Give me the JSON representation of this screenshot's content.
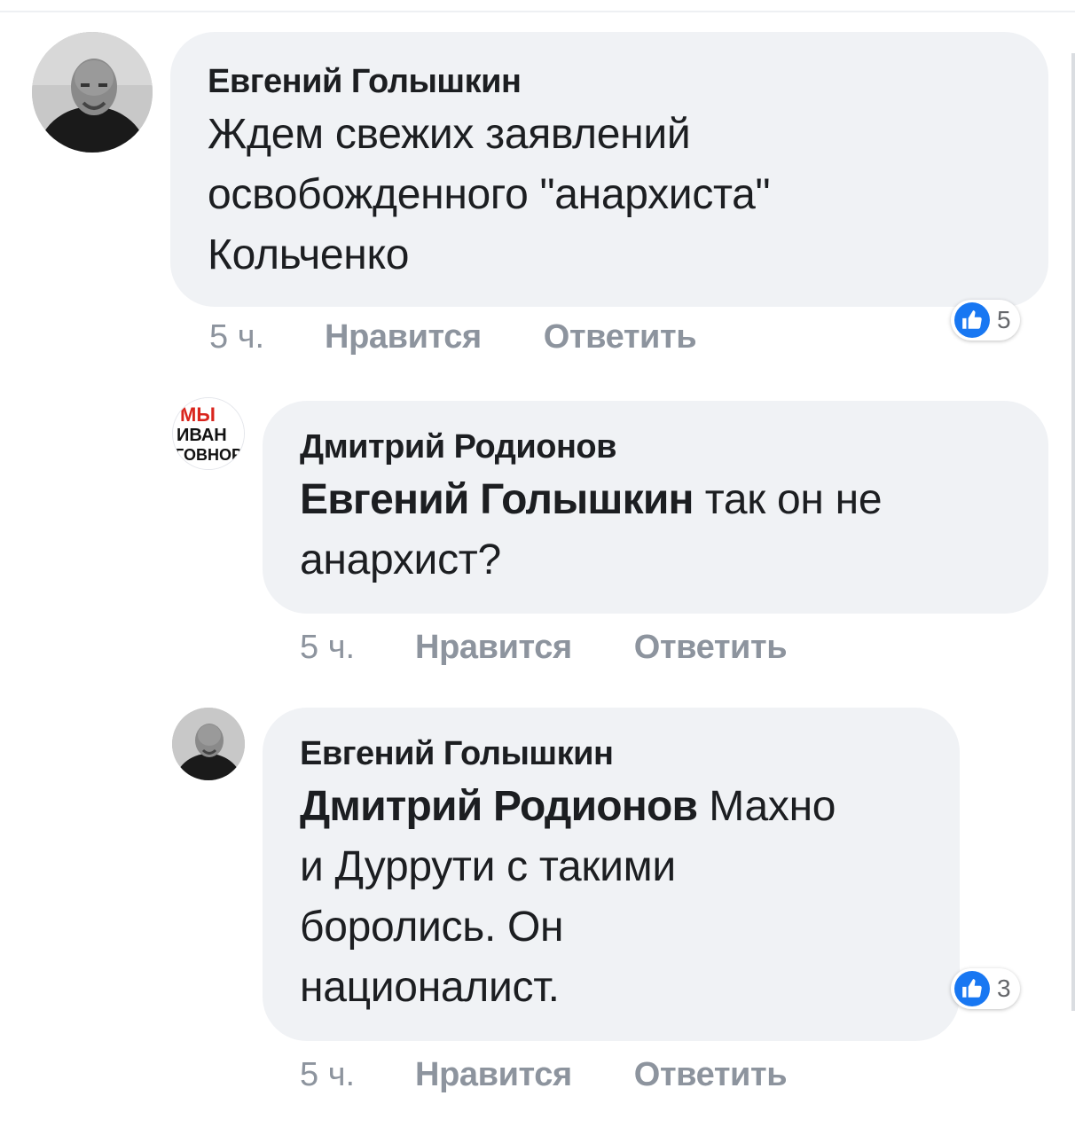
{
  "comments": [
    {
      "author": "Евгений Голышкин",
      "text_lines": [
        "Ждем свежих заявлений",
        "освобожденного \"анархиста\"",
        "Кольченко"
      ],
      "time": "5 ч.",
      "like_label": "Нравится",
      "reply_label": "Ответить",
      "reactions": {
        "icon": "like-icon",
        "count": "5"
      }
    },
    {
      "author": "Дмитрий Родионов",
      "avatar_text": [
        "МЫ",
        "ИВАН",
        "ГОВНОР"
      ],
      "mention": "Евгений Голышкин",
      "text_after_mention": " так он не",
      "text_line2": "анархист?",
      "time": "5 ч.",
      "like_label": "Нравится",
      "reply_label": "Ответить"
    },
    {
      "author": "Евгений Голышкин",
      "mention": "Дмитрий Родионов",
      "text_after_mention": " Махно",
      "text_lines_rest": [
        "и Дуррути с такими",
        "боролись. Он",
        "националист."
      ],
      "time": "5 ч.",
      "like_label": "Нравится",
      "reply_label": "Ответить",
      "reactions": {
        "icon": "like-icon",
        "count": "3"
      }
    }
  ],
  "colors": {
    "bubble": "#f0f2f5",
    "text": "#1c1e21",
    "meta": "#8d949e",
    "like_blue": "#1877f2",
    "logo_red": "#d9251d"
  }
}
